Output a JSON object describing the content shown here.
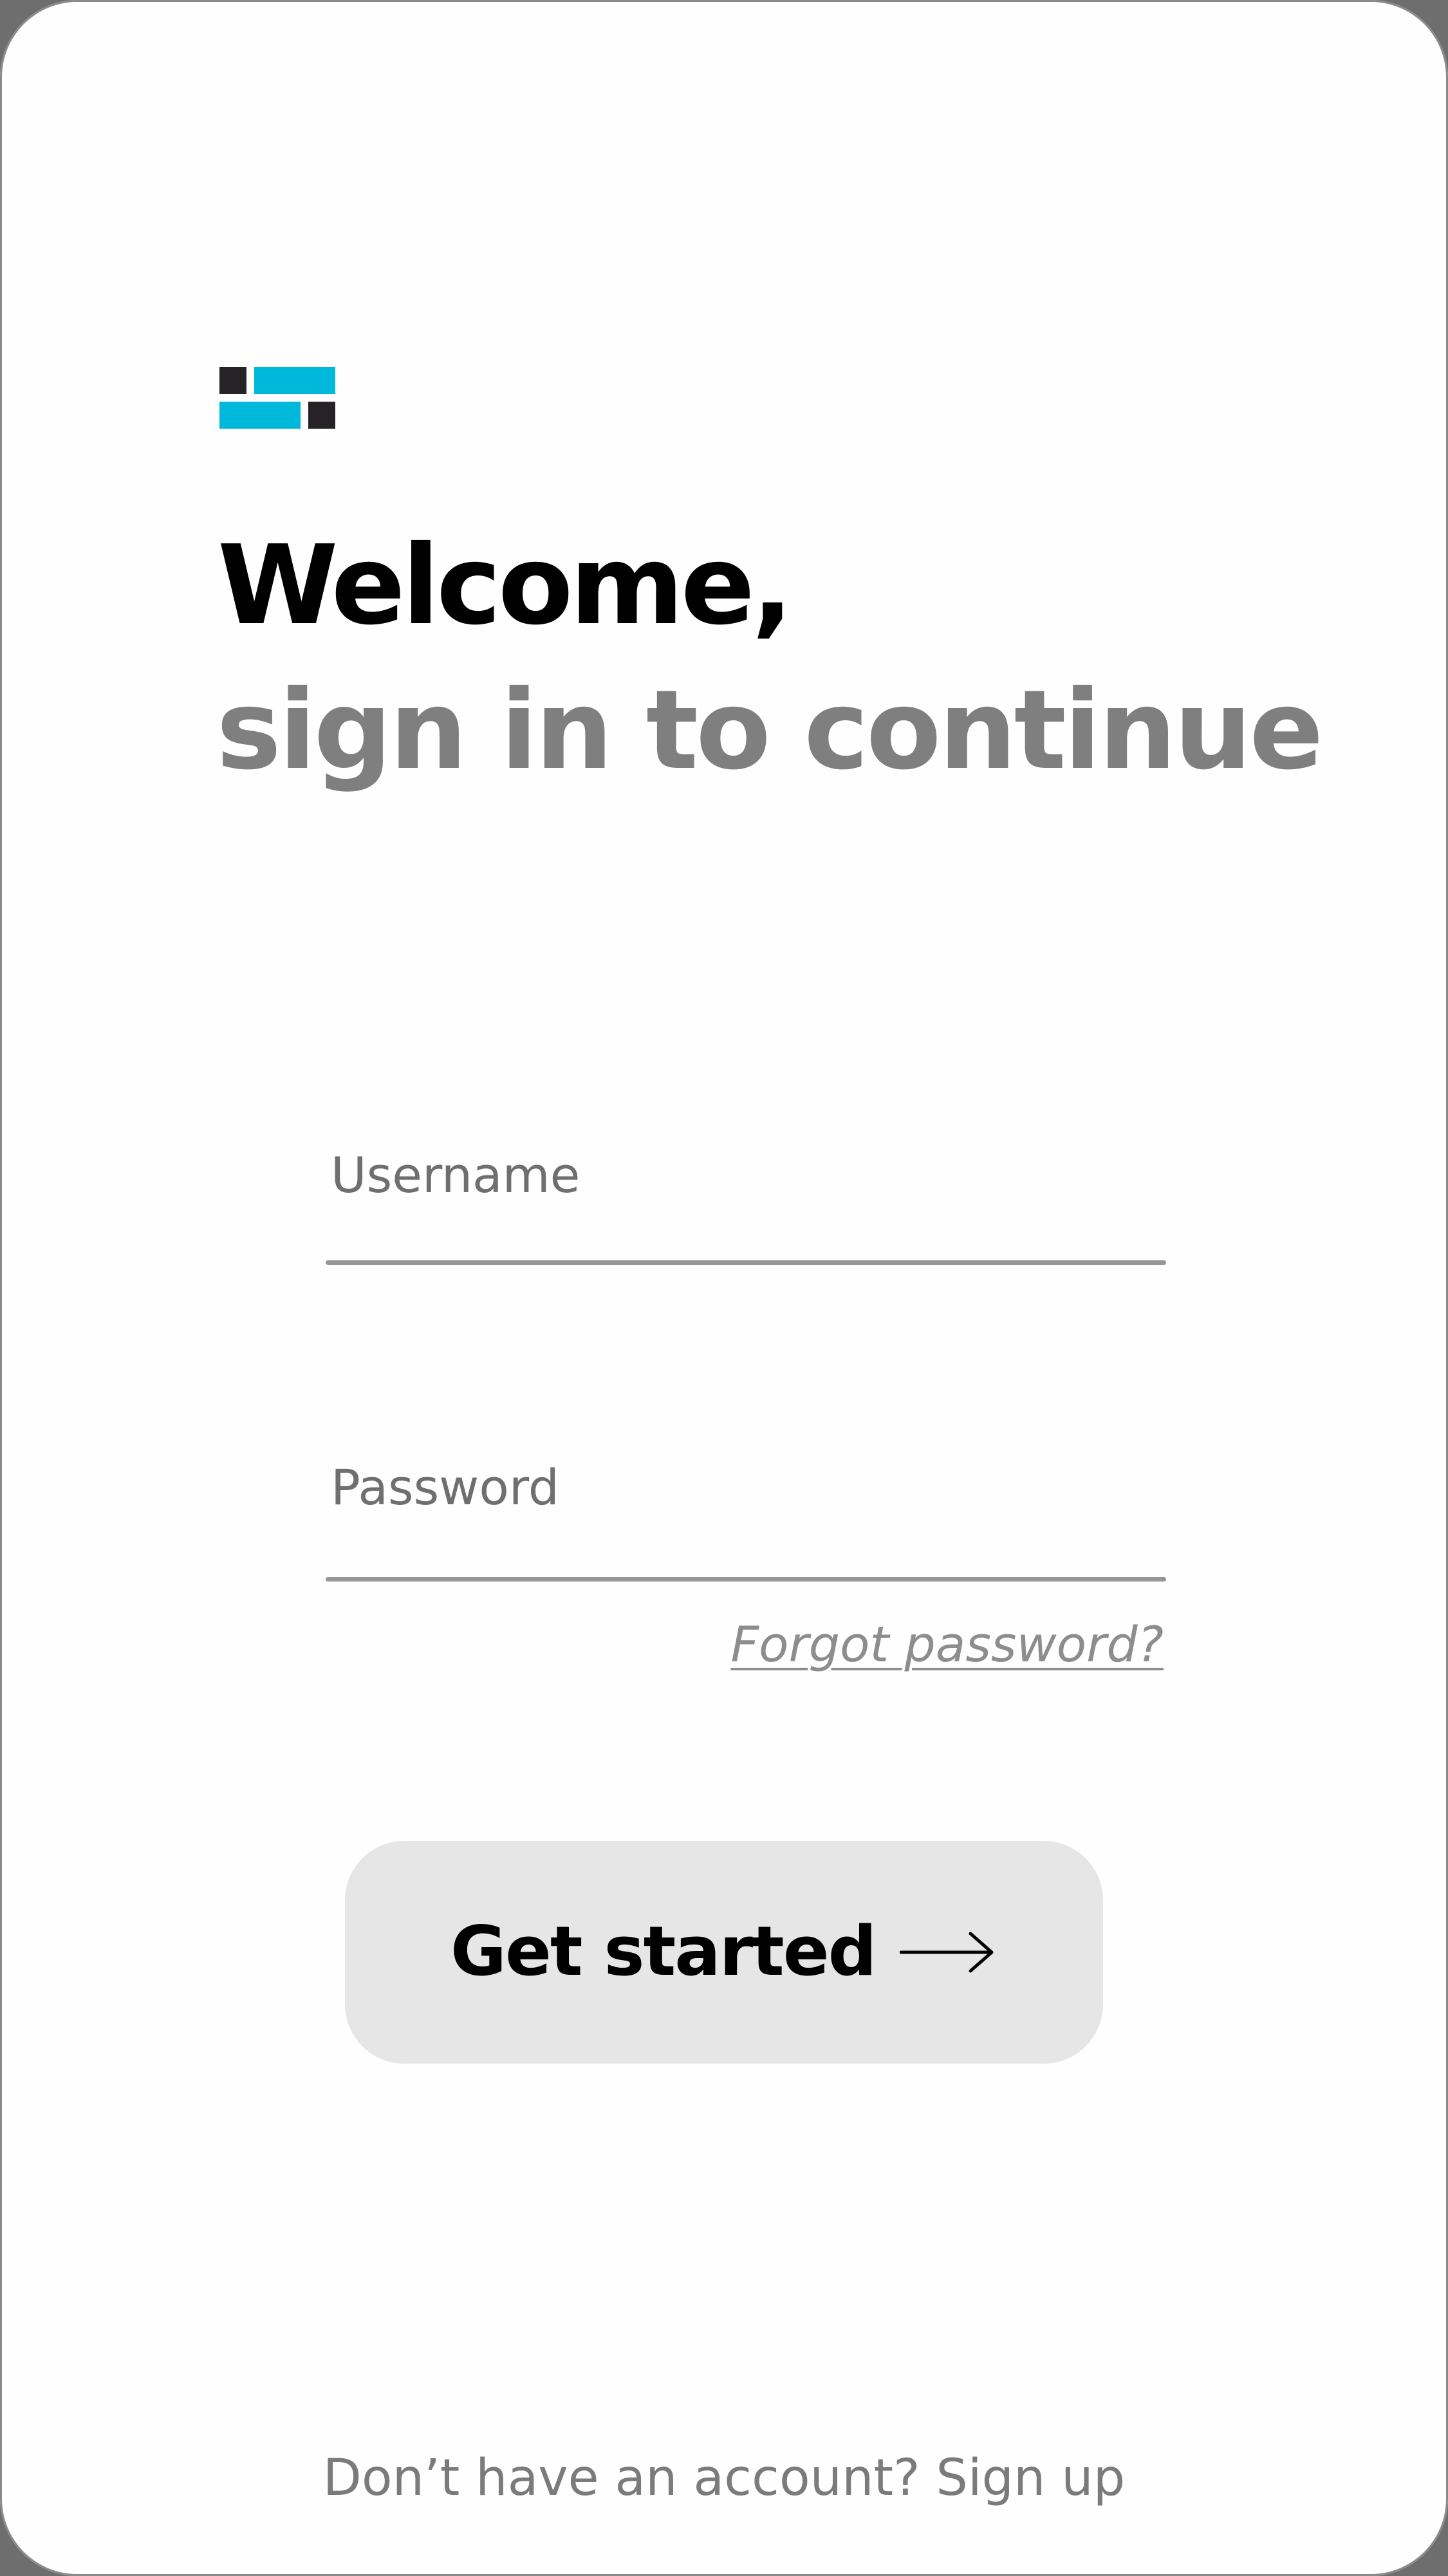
{
  "colors": {
    "brand_dark": "#262226",
    "brand_cyan": "#00b8da",
    "title_primary": "#000000",
    "title_secondary": "#7f7f7f",
    "button_background": "#e6e6e6",
    "muted_text": "#7b7b7b"
  },
  "logo": {
    "icon": "brand-logo-icon"
  },
  "heading": {
    "line1": "Welcome,",
    "line2": "sign in to continue"
  },
  "form": {
    "username": {
      "placeholder": "Username",
      "value": ""
    },
    "password": {
      "placeholder": "Password",
      "value": ""
    },
    "forgot_password": "Forgot password?"
  },
  "cta": {
    "label": "Get started",
    "icon": "arrow-right-icon"
  },
  "footer": {
    "prompt": "Don’t have an account?",
    "link": "Sign up"
  }
}
